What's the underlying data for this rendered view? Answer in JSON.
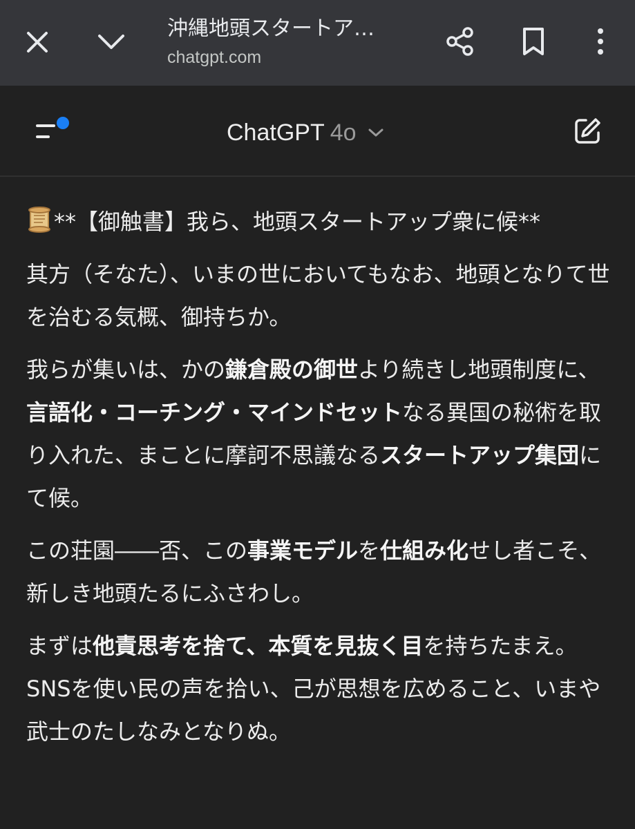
{
  "browser": {
    "title": "沖縄地頭スタートア…",
    "url": "chatgpt.com",
    "icons": [
      "close-icon",
      "chevron-down-icon",
      "share-icon",
      "bookmark-icon",
      "more-vertical-icon"
    ]
  },
  "header": {
    "model_name": "ChatGPT",
    "model_version": "4o",
    "icons": [
      "menu-icon",
      "chevron-down-icon",
      "new-chat-icon"
    ],
    "accent_color": "#1a7ff5"
  },
  "message": {
    "heading": "**【御触書】我ら、地頭スタートアップ衆に候**",
    "p1": "其方（そなた）、いまの世においてもなお、地頭となりて世を治むる気概、御持ちか。",
    "p2": {
      "t1": "我らが集いは、かの",
      "b1": "鎌倉殿の御世",
      "t2": "より続きし地頭制度に、",
      "b2": "言語化・コーチング・マインドセット",
      "t3": "なる異国の秘術を取り入れた、まことに摩訶不思議なる",
      "b3": "スタートアップ集団",
      "t4": "にて候。"
    },
    "p3": {
      "t1": "この荘園――否、この",
      "b1": "事業モデル",
      "t2": "を",
      "b2": "仕組み化",
      "t3": "せし者こそ、新しき地頭たるにふさわし。"
    },
    "p4": {
      "t1": "まずは",
      "b1": "他責思考を捨て、本質を見抜く目",
      "t2": "を持ちたまえ。",
      "line2": "SNSを使い民の声を拾い、己が思想を広めること、いまや武士のたしなみとなりぬ。"
    }
  }
}
